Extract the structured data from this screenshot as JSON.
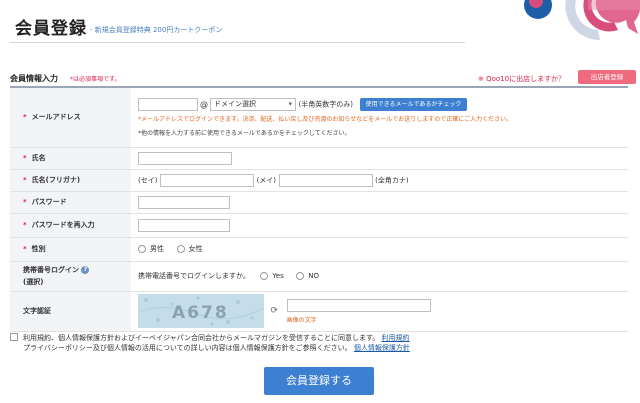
{
  "header": {
    "title": "会員登録",
    "subtitle": "- 新規会員登録特典  200円カートクーポン"
  },
  "section": {
    "title": "会員情報入力",
    "required_note": "*は必須事項です。",
    "seller_question": "※ Qoo10に出店しますか？",
    "seller_button": "出店者登録"
  },
  "form": {
    "email": {
      "label": "メールアドレス",
      "at": "@",
      "domain_select": "ドメイン選択",
      "hint": "(半角英数字のみ)",
      "check_button": "使用できるメールであるかチェック",
      "note1": "*メールアドレスでログインできます。決済、配送、払い戻し及び売渡のお知らせなどをメールでお送りしますので正確にご入力ください。",
      "note2": "*他の情報を入力する前に使用できるメールであるかをチェックしてください。"
    },
    "name": {
      "label": "氏名"
    },
    "kana": {
      "label": "氏名(フリガナ)",
      "sei": "(セイ)",
      "mei": "(メイ)",
      "hint": "(全角カナ)"
    },
    "password": {
      "label": "パスワード"
    },
    "password_confirm": {
      "label": "パスワードを再入力"
    },
    "gender": {
      "label": "性別",
      "male": "男性",
      "female": "女性"
    },
    "mobile": {
      "label_line1": "携帯番号ログイン",
      "label_line2": "(選択)",
      "question": "携帯電話番号でログインしますか。",
      "yes": "Yes",
      "no": "NO"
    },
    "captcha": {
      "label": "文字認証",
      "image_text": "A678",
      "hint": "画像の文字"
    }
  },
  "agreement": {
    "line1": "利用規約、個人情報保護方針およびイーベイジャパン合同会社からメールマガジンを受信することに同意します。",
    "link1": "利用規約",
    "line2": "プライバシーポリシー及び個人情報の活用についての詳しい内容は個人情報保護方針をご参照ください。",
    "link2": "個人情報保護方針"
  },
  "submit_label": "会員登録する",
  "colors": {
    "accent_blue": "#3d7fd0",
    "required_red": "#e0204d",
    "note_orange": "#e8641b",
    "seller_pink": "#f06a7d"
  },
  "icons": {
    "help": "help-circle-icon",
    "refresh": "refresh-icon",
    "domain_arrow": "chevron-down-icon"
  }
}
